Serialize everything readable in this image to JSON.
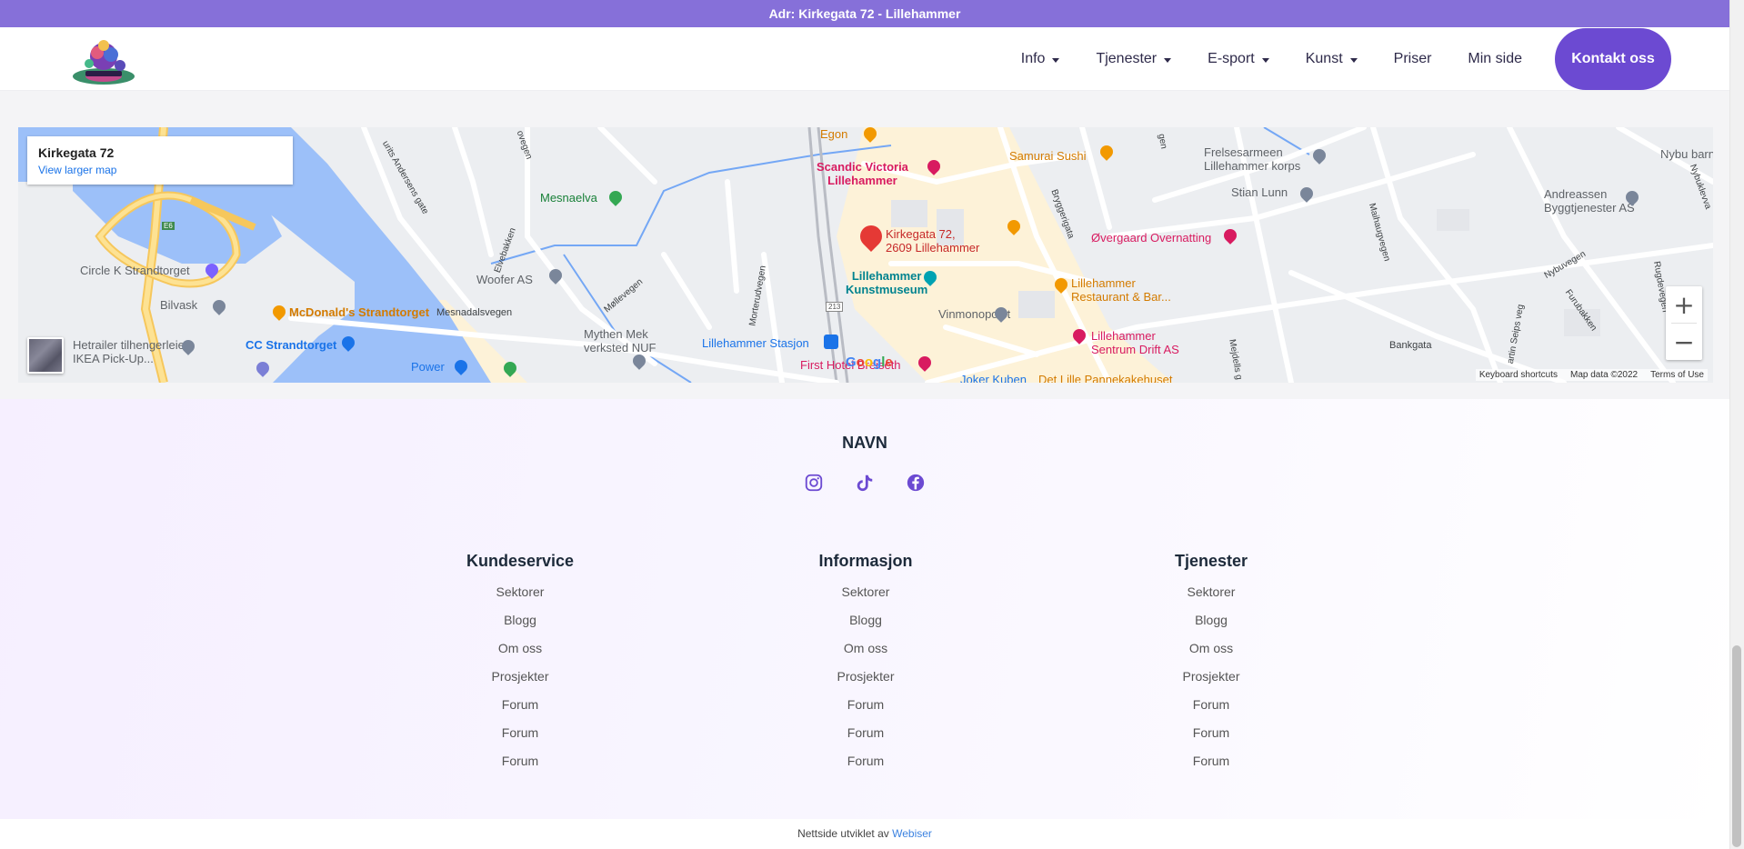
{
  "topbar": {
    "text": "Adr: Kirkegata 72 - Lillehammer"
  },
  "header": {
    "nav": [
      {
        "label": "Info",
        "dropdown": true
      },
      {
        "label": "Tjenester",
        "dropdown": true
      },
      {
        "label": "E-sport",
        "dropdown": true
      },
      {
        "label": "Kunst",
        "dropdown": true
      },
      {
        "label": "Priser",
        "dropdown": false
      },
      {
        "label": "Min side",
        "dropdown": false
      }
    ],
    "cta": "Kontakt oss"
  },
  "map": {
    "card_title": "Kirkegata 72",
    "card_link": "View larger map",
    "zoom_in": "+",
    "zoom_out": "−",
    "footer": [
      "Keyboard shortcuts",
      "Map data ©2022",
      "Terms of Use"
    ],
    "google": "Google",
    "labels": {
      "egon": "Egon",
      "scandic": "Scandic Victoria\nLillehammer",
      "samurai": "Samurai Sushi",
      "frelsesarmeen": "Frelsesarmeen\nLillehammer korps",
      "nybu": "Nybu barne",
      "stian": "Stian Lunn",
      "andreassen": "Andreassen\nByggtjenester AS",
      "mesnaelva": "Mesnaelva",
      "kirkegata": "Kirkegata 72,\n2609 Lillehammer",
      "overgaard": "Øvergaard Overnatting",
      "circlek": "Circle K Strandtorget",
      "woofer": "Woofer AS",
      "kunstmuseum": "Lillehammer\nKunstmuseum",
      "lh_restaurant": "Lillehammer\nRestaurant & Bar...",
      "bilvask": "Bilvask",
      "mcdonalds": "McDonald's Strandtorget",
      "mesnadalsvegen": "Mesnadalsvegen",
      "vinmonopolet": "Vinmonopolet",
      "lh_sentrum": "Lillehammer\nSentrum Drift AS",
      "tilhenger": "Hetrailer tilhengerleie\nIKEA Pick-Up...",
      "cc": "CC Strandtorget",
      "mythen": "Mythen Mek\nverksted NUF",
      "stasjon": "Lillehammer Stasjon",
      "bankgata": "Bankgata",
      "power": "Power",
      "first_hotel": "First Hotel Breiseth",
      "joker": "Joker Kuben",
      "pannekake": "Det Lille Pannekakehuset",
      "mollevegen": "Møllevegen",
      "morterud": "Morterudvegen",
      "bryggerigata": "Bryggerigata",
      "maihaug": "Maihaugvegen",
      "elvebakken": "Elvebakken",
      "andersens": "urits Andersens gate",
      "ovegen": "ovegen",
      "e6": "E6",
      "r213": "213",
      "nybuvegen": "Nybuvegen",
      "furubakken": "Furubakken",
      "seips": "artin Seips veg",
      "rugdevegen": "Rugdevegen",
      "majdells": "Mejdells g",
      "gen": "gen",
      "nybuklevva": "Nybuklevva"
    }
  },
  "footer": {
    "brand": "NAVN",
    "socials": [
      "instagram-icon",
      "tiktok-icon",
      "facebook-icon"
    ],
    "columns": [
      {
        "title": "Kundeservice",
        "links": [
          "Sektorer",
          "Blogg",
          "Om oss",
          "Prosjekter",
          "Forum",
          "Forum",
          "Forum"
        ]
      },
      {
        "title": "Informasjon",
        "links": [
          "Sektorer",
          "Blogg",
          "Om oss",
          "Prosjekter",
          "Forum",
          "Forum",
          "Forum"
        ]
      },
      {
        "title": "Tjenester",
        "links": [
          "Sektorer",
          "Blogg",
          "Om oss",
          "Prosjekter",
          "Forum",
          "Forum",
          "Forum"
        ]
      }
    ],
    "credit_text": "Nettside utviklet av",
    "credit_link": "Webiser"
  },
  "colors": {
    "accent": "#6c4ad2",
    "topbar": "#8670d9",
    "social": "#6c4ad2"
  }
}
